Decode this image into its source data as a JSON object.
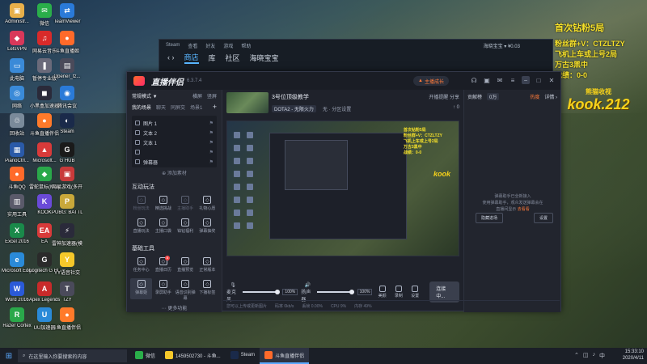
{
  "desktop_icons": [
    {
      "label": "Administr...",
      "color": "#e8b04a",
      "glyph": "▣"
    },
    {
      "label": "微信",
      "color": "#2aae4a",
      "glyph": "✉"
    },
    {
      "label": "TeamViewer",
      "color": "#2a7ad8",
      "glyph": "⇄"
    },
    {
      "label": "LetsVPN",
      "color": "#d8385a",
      "glyph": "◆"
    },
    {
      "label": "网易云音乐",
      "color": "#d82a2a",
      "glyph": "♫"
    },
    {
      "label": "斗鱼直播姬",
      "color": "#ff6a2a",
      "glyph": "●"
    },
    {
      "label": "此电脑",
      "color": "#3a8ad8",
      "glyph": "▭"
    },
    {
      "label": "暂停专业版",
      "color": "#6a6a7a",
      "glyph": "❚"
    },
    {
      "label": "Opener_tz...",
      "color": "#4a4a5a",
      "glyph": "▤"
    },
    {
      "label": "网络",
      "color": "#3a8ad8",
      "glyph": "◎"
    },
    {
      "label": "小黑盒加速器",
      "color": "#2a2a3a",
      "glyph": "◼"
    },
    {
      "label": "腾讯会议",
      "color": "#2a7ad8",
      "glyph": "◉"
    },
    {
      "label": "回收站",
      "color": "#7a8a9a",
      "glyph": "♲"
    },
    {
      "label": "斗鱼直播伴侣",
      "color": "#ff7a2a",
      "glyph": "●"
    },
    {
      "label": "Steam",
      "color": "#1a2a4a",
      "glyph": "◐"
    },
    {
      "label": "PianoCtrl...",
      "color": "#2a5aa8",
      "glyph": "▦"
    },
    {
      "label": "Microsoft...",
      "color": "#d83a3a",
      "glyph": "▲"
    },
    {
      "label": "G HUB",
      "color": "#1a1a1a",
      "glyph": "G"
    },
    {
      "label": "斗鱼QQ",
      "color": "#ff6a2a",
      "glyph": "●"
    },
    {
      "label": "雷蛇鼠标(Malping)",
      "color": "#2aa84a",
      "glyph": "◆"
    },
    {
      "label": "网易游戏(多开)",
      "color": "#c83a3a",
      "glyph": "▣"
    },
    {
      "label": "实用工具",
      "color": "#5a5a6a",
      "glyph": "▥"
    },
    {
      "label": "KOOK",
      "color": "#6a4ad8",
      "glyph": "K"
    },
    {
      "label": "PUBG: BATTLEGR...",
      "color": "#c8a83a",
      "glyph": "P"
    },
    {
      "label": "Excel 2016",
      "color": "#1a8a4a",
      "glyph": "X"
    },
    {
      "label": "EA",
      "color": "#d83a3a",
      "glyph": "EA"
    },
    {
      "label": "雷神加速器(模拟器)",
      "color": "#2a2a3a",
      "glyph": "⚡"
    },
    {
      "label": "Microsoft Edge",
      "color": "#2a8ad8",
      "glyph": "e"
    },
    {
      "label": "Logitech G HUB",
      "color": "#2a2a2a",
      "glyph": "G"
    },
    {
      "label": "YY语音社交",
      "color": "#f5c82a",
      "glyph": "Y"
    },
    {
      "label": "Word 2016",
      "color": "#2a5ad8",
      "glyph": "W"
    },
    {
      "label": "Apex Legends",
      "color": "#c82a2a",
      "glyph": "A"
    },
    {
      "label": "TZY",
      "color": "#4a4a5a",
      "glyph": "T"
    },
    {
      "label": "Razer Cortex",
      "color": "#2aa84a",
      "glyph": "R"
    },
    {
      "label": "UU加速器",
      "color": "#2a8ad8",
      "glyph": "U"
    },
    {
      "label": "斗鱼直播伴侣 2020/3/11",
      "color": "#ff7a2a",
      "glyph": "●"
    }
  ],
  "overlay": {
    "title": "首次钻粉5局",
    "lines": [
      "粉丝群+V：CTZLTZY",
      "飞机上车或上号2局",
      "万古3黑中",
      "战绩：0-0"
    ],
    "logo_top": "熊猫收视",
    "logo_big": "kook.212"
  },
  "steam": {
    "menu": [
      "Steam",
      "查看",
      "好友",
      "游戏",
      "帮助"
    ],
    "nav": [
      "商店",
      "库",
      "社区",
      "海晓宝宝"
    ],
    "account": "海晓宝宝 ▾ ¥0.03"
  },
  "app": {
    "title": "直播伴侣",
    "version": "6.3.7.4",
    "live_button": "主播成长",
    "scene_mode": "常规模式 ▼",
    "mode_links": [
      "横屏",
      "竖屏"
    ],
    "my_scenes": "我的场景",
    "scene_tabs": [
      "聊天",
      "同屏交",
      "场景1"
    ],
    "sources": [
      {
        "label": "图片 1"
      },
      {
        "label": "文本 2"
      },
      {
        "label": "文本 1"
      },
      {
        "label": ""
      },
      {
        "label": "弹幕器"
      }
    ],
    "add_source": "添加素材",
    "interaction_title": "互动玩法",
    "interaction_tools": [
      {
        "label": "粉丝玩法",
        "dim": true
      },
      {
        "label": "精选挑战",
        "dim": false
      },
      {
        "label": "主播助手",
        "dim": true
      },
      {
        "label": "礼物心愿",
        "dim": false
      },
      {
        "label": "直播玩法",
        "dim": false
      },
      {
        "label": "主播口袋",
        "dim": false
      },
      {
        "label": "铂钻福利",
        "dim": false
      },
      {
        "label": "弹幕抽奖",
        "dim": false
      }
    ],
    "basic_title": "基础工具",
    "basic_tools": [
      {
        "label": "任务中心",
        "badge": ""
      },
      {
        "label": "直播日历",
        "badge": "8"
      },
      {
        "label": "直播预览",
        "badge": ""
      },
      {
        "label": "正常版本",
        "badge": ""
      },
      {
        "label": "弹幕姬",
        "badge": "",
        "selected": true
      },
      {
        "label": "录屏助手",
        "badge": ""
      },
      {
        "label": "语音识别弹幕",
        "badge": ""
      },
      {
        "label": "下播标签",
        "badge": ""
      }
    ],
    "more_functions": "更多功能",
    "room_title": "3号位顶级教学",
    "room_category": "DOTA2 - 无限火力",
    "room_tag": "无 · 分区设置",
    "room_actions": [
      "开播提醒",
      "分享"
    ],
    "room_stats": "↑ 0",
    "preview_overlay_lines": [
      "首次钻粉5局",
      "粉丝群+V：CTZLTZY",
      "飞机上车或上号2局",
      "万古3黑中",
      "战绩：0-0"
    ],
    "preview_logo": "kook",
    "mic_label": "麦克风",
    "mic_value": "100%",
    "mic_level": 0.85,
    "speaker_label": "扬声器",
    "speaker_value": "100%",
    "speaker_level": 0.85,
    "controls": [
      "美颜",
      "录制",
      "设置"
    ],
    "connect_button": "连接中...",
    "status_items": [
      "您可以上传或更新图片",
      "码率 0kb/s",
      "丢帧 0.00%",
      "CPU 9%",
      "内存 49%"
    ],
    "right_tabs": [
      "贡献榜",
      "0万"
    ],
    "right_hot": "热度",
    "right_detail": "详情 ›",
    "right_empty_lines": [
      "弹幕助手已全新接入",
      "使用弹幕助手，观众发送弹幕会在",
      "直播间显示"
    ],
    "right_empty_link": "去看看",
    "right_buttons": [
      "隐藏进场",
      "设置"
    ]
  },
  "taskbar": {
    "search_placeholder": "在这里输入你要搜索的内容",
    "tasks": [
      {
        "label": "微信",
        "color": "#2aae4a",
        "active": false
      },
      {
        "label": "1459502730 - 斗鱼...",
        "color": "#f5c82a",
        "active": false
      },
      {
        "label": "Steam",
        "color": "#1a2a4a",
        "active": false
      },
      {
        "label": "斗鱼直播伴侣",
        "color": "#ff6a2a",
        "active": true
      }
    ],
    "time": "15:33:10",
    "date": "2020/4/11"
  },
  "colors": {
    "accent": "#5aa9ff",
    "overlay_yellow": "#f5e02a",
    "brand_orange": "#ff7a3a"
  }
}
